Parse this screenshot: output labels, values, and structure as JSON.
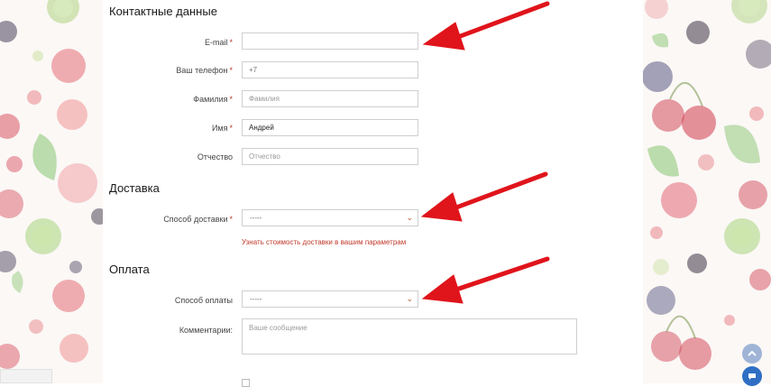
{
  "sections": {
    "contacts_title": "Контактные данные",
    "delivery_title": "Доставка",
    "payment_title": "Оплата"
  },
  "contacts": {
    "email_label": "E-mail",
    "email_value": "",
    "phone_label": "Ваш телефон",
    "phone_value": "+7",
    "lastname_label": "Фамилия",
    "lastname_placeholder": "Фамилия",
    "firstname_label": "Имя",
    "firstname_value": "Андрей",
    "patronymic_label": "Отчество",
    "patronymic_placeholder": "Отчество",
    "required_mark": "*"
  },
  "delivery": {
    "method_label": "Способ доставки",
    "method_value": "-----",
    "cost_link": "Узнать стоимость доставки в вашим параметрам"
  },
  "payment": {
    "method_label": "Способ оплаты",
    "method_value": "-----",
    "comments_label": "Комментарии:",
    "comments_placeholder": "Ваше сообщение"
  },
  "colors": {
    "arrow": "#e0141b",
    "required": "#c0392b",
    "link": "#c0392b",
    "chat_button": "#2f6fc3",
    "scroll_up_button": "#9fb4d6"
  },
  "icons": {
    "select_chevron": "chevron-down-icon",
    "scroll_up": "chevron-up-icon",
    "chat": "chat-icon"
  }
}
